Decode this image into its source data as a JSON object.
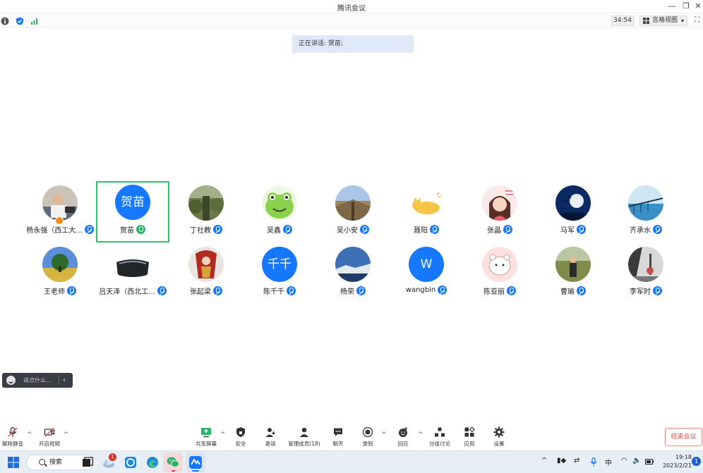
{
  "window": {
    "title": "腾讯会议",
    "timer": "34:54",
    "view_label": "宫格视图",
    "speaking_text": "正在讲话: 贺苗;"
  },
  "participants": [
    {
      "name": "杨永强（西工大...",
      "avatar_text": ""
    },
    {
      "name": "贺苗",
      "avatar_text": "贺苗"
    },
    {
      "name": "丁社教",
      "avatar_text": ""
    },
    {
      "name": "吴鑫",
      "avatar_text": ""
    },
    {
      "name": "吴小安",
      "avatar_text": ""
    },
    {
      "name": "聂阳",
      "avatar_text": ""
    },
    {
      "name": "张晶",
      "avatar_text": ""
    },
    {
      "name": "马军",
      "avatar_text": ""
    },
    {
      "name": "齐承水",
      "avatar_text": ""
    },
    {
      "name": "王老师",
      "avatar_text": ""
    },
    {
      "name": "吕天泽（西北工...",
      "avatar_text": ""
    },
    {
      "name": "张起梁",
      "avatar_text": ""
    },
    {
      "name": "陈千千",
      "avatar_text": "千千"
    },
    {
      "name": "杨荣",
      "avatar_text": ""
    },
    {
      "name": "wangbin",
      "avatar_text": "W"
    },
    {
      "name": "陈亚丽",
      "avatar_text": ""
    },
    {
      "name": "曹瑜",
      "avatar_text": ""
    },
    {
      "name": "李军时",
      "avatar_text": ""
    }
  ],
  "chat": {
    "placeholder": "说点什么..."
  },
  "toolbar": {
    "unmute": "解除静音",
    "start_video": "开启视频",
    "share_screen": "共享屏幕",
    "security": "安全",
    "invite": "邀请",
    "manage_members": "管理成员(18)",
    "chat": "聊天",
    "record": "录制",
    "react": "回应",
    "breakout": "分组讨论",
    "apps": "应用",
    "settings": "设置",
    "end_meeting": "结束会议"
  },
  "taskbar": {
    "search_label": "搜索",
    "weather_badge": "1",
    "ime": "中",
    "time": "19:18",
    "date": "2023/2/21",
    "notification_count": "1"
  }
}
